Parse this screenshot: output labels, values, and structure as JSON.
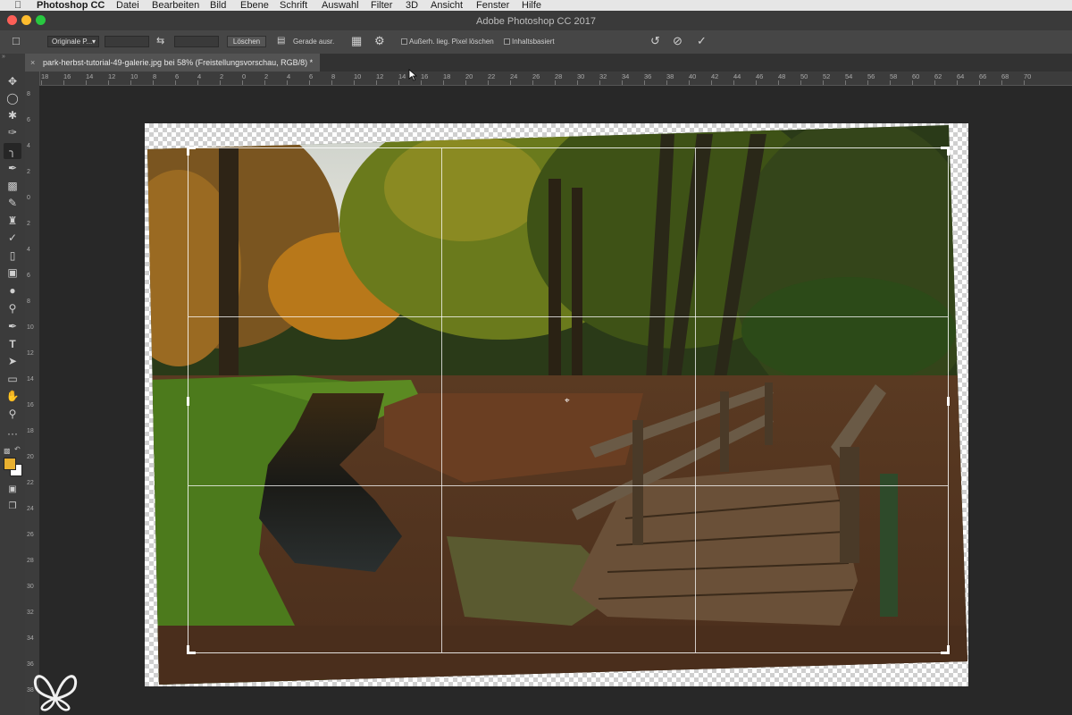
{
  "menubar": {
    "app": "Photoshop CC",
    "items": [
      "Datei",
      "Bearbeiten",
      "Bild",
      "Ebene",
      "Schrift",
      "Auswahl",
      "Filter",
      "3D",
      "Ansicht",
      "Fenster",
      "Hilfe"
    ]
  },
  "window": {
    "title": "Adobe Photoshop CC 2017"
  },
  "options": {
    "ratio": "Originale P...",
    "delete_label": "Löschen",
    "straighten_label": "Gerade ausr.",
    "delete_cropped_label": "Außerh. lieg. Pixel löschen",
    "content_aware_label": "Inhaltsbasiert",
    "delete_cropped_checked": false,
    "content_aware_checked": false
  },
  "document": {
    "tab_title": "park-herbst-tutorial-49-galerie.jpg bei 58% (Freistellungsvorschau, RGB/8) *",
    "close_glyph": "×"
  },
  "ruler": {
    "h_labels": [
      "18",
      "16",
      "14",
      "12",
      "10",
      "8",
      "6",
      "4",
      "2",
      "0",
      "2",
      "4",
      "6",
      "8",
      "10",
      "12",
      "14",
      "16",
      "18",
      "20",
      "22",
      "24",
      "26",
      "28",
      "30",
      "32",
      "34",
      "36",
      "38",
      "40",
      "42",
      "44",
      "46",
      "48",
      "50",
      "52",
      "54",
      "56",
      "58",
      "60",
      "62",
      "64",
      "66",
      "68",
      "70"
    ],
    "v_labels": [
      "8",
      "6",
      "4",
      "2",
      "0",
      "2",
      "4",
      "6",
      "8",
      "10",
      "12",
      "14",
      "16",
      "18",
      "20",
      "22",
      "24",
      "26",
      "28",
      "30",
      "32",
      "34",
      "36",
      "38"
    ]
  },
  "colors": {
    "foreground": "#e8b030",
    "background": "#ffffff",
    "close_dot": "#fc5f57",
    "min_dot": "#fdbc2e",
    "max_dot": "#28c840"
  }
}
